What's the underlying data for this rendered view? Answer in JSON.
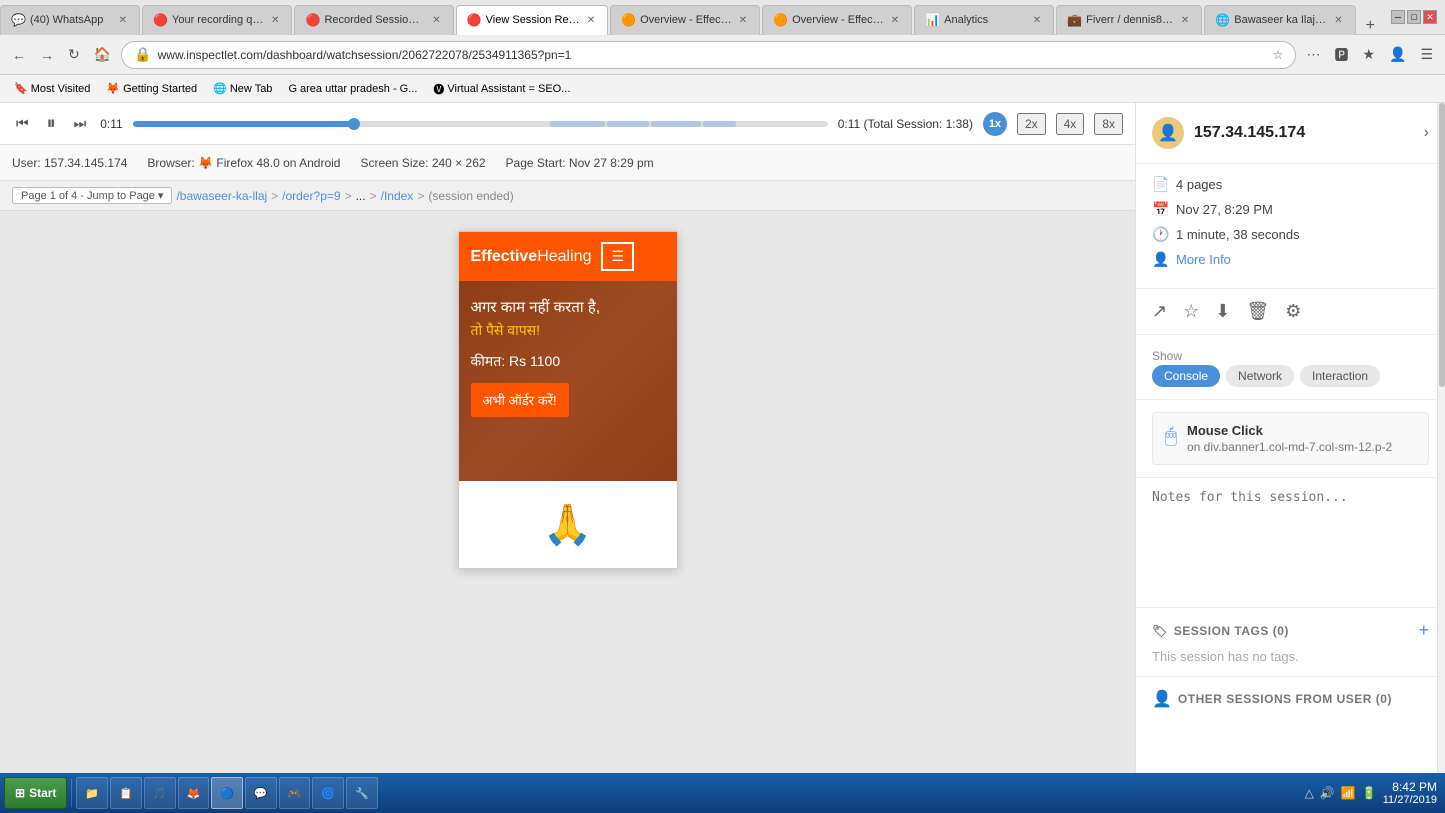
{
  "browser": {
    "tabs": [
      {
        "id": "whatsapp",
        "label": "(40) WhatsApp",
        "icon": "💬",
        "active": false,
        "favicon": "🟢"
      },
      {
        "id": "your-recording",
        "label": "Your recording qu...",
        "icon": "🔴",
        "active": false,
        "favicon": "📹"
      },
      {
        "id": "recorded-sessions",
        "label": "Recorded Sessions...",
        "icon": "🔴",
        "active": false,
        "favicon": "📹"
      },
      {
        "id": "view-session",
        "label": "View Session Rec...",
        "icon": "🔴",
        "active": true,
        "favicon": "📹"
      },
      {
        "id": "overview-effecti1",
        "label": "Overview - Effecti...",
        "icon": "🟠",
        "active": false,
        "favicon": "📊"
      },
      {
        "id": "overview-effecti2",
        "label": "Overview - Effecti...",
        "icon": "🟠",
        "active": false,
        "favicon": "📊"
      },
      {
        "id": "analytics",
        "label": "Analytics",
        "icon": "📊",
        "active": false,
        "favicon": "📊"
      },
      {
        "id": "fiverr",
        "label": "Fiverr / dennis81...",
        "icon": "🟢",
        "active": false,
        "favicon": "💼"
      },
      {
        "id": "bawaseer",
        "label": "Bawaseer ka Ilaj -...",
        "icon": "🟠",
        "active": false,
        "favicon": "🌐"
      }
    ],
    "url": "www.inspectlet.com/dashboard/watchsession/2062722078/2534911365?pn=1",
    "bookmarks": [
      {
        "label": "Most Visited"
      },
      {
        "label": "Getting Started"
      },
      {
        "label": "New Tab"
      },
      {
        "label": "area uttar pradesh - G..."
      },
      {
        "label": "Virtual Assistant = SEO..."
      }
    ]
  },
  "player": {
    "current_time": "0:11",
    "total_time": "0:11 (Total Session: 1:38)",
    "progress_percent": 32,
    "speed_current": "1x",
    "speeds": [
      "2x",
      "4x",
      "8x"
    ]
  },
  "session_info": {
    "user": "User: 157.34.145.174",
    "browser": "Browser: 🦊 Firefox 48.0 on Android",
    "screen_size": "Screen Size: 240 × 262",
    "page_start": "Page Start: Nov 27 8:29 pm"
  },
  "breadcrumb": {
    "page": "Page 1 of 4 - Jump to Page",
    "path": [
      {
        "text": "/bawaseer-ka-llaj",
        "type": "link"
      },
      {
        "text": ">",
        "type": "sep"
      },
      {
        "text": "/order?p=9",
        "type": "link"
      },
      {
        "text": ">",
        "type": "sep"
      },
      {
        "text": "...",
        "type": "text"
      },
      {
        "text": ">",
        "type": "sep"
      },
      {
        "text": "/Index",
        "type": "link"
      },
      {
        "text": ">",
        "type": "sep"
      },
      {
        "text": "(session ended)",
        "type": "ended"
      }
    ]
  },
  "site_preview": {
    "logo_part1": "Effective",
    "logo_part2": "Healing",
    "hero_text1": "अगर काम नहीं करता है,",
    "hero_text2": "तो पैसे वापस!",
    "hero_price": "कीमत: Rs 1100",
    "hero_btn": "अभी ऑर्डर करें!"
  },
  "right_panel": {
    "ip": "157.34.145.174",
    "pages": "4 pages",
    "datetime": "Nov 27, 8:29 PM",
    "duration": "1 minute, 38 seconds",
    "more_info_label": "More Info",
    "show_label": "Show",
    "show_tabs": [
      "Console",
      "Network",
      "Interaction"
    ],
    "event": {
      "title": "Mouse Click",
      "description": "on div.banner1.col-md-7.col-sm-12.p-2"
    },
    "notes_placeholder": "Notes for this session...",
    "tags_label": "SESSION TAGS (0)",
    "tags_empty": "This session has no tags.",
    "other_sessions_label": "OTHER SESSIONS FROM USER (0)"
  },
  "taskbar": {
    "start_label": "Start",
    "apps": [
      {
        "label": "📁",
        "title": "File Explorer"
      },
      {
        "label": "📋",
        "title": "Task Manager"
      },
      {
        "label": "🎵",
        "title": "VLC"
      },
      {
        "label": "🦊",
        "title": "Firefox"
      },
      {
        "label": "🔵",
        "title": "Chrome"
      },
      {
        "label": "💬",
        "title": "Skype"
      },
      {
        "label": "🎮",
        "title": "Game"
      },
      {
        "label": "🌀",
        "title": "App"
      }
    ],
    "clock_time": "8:42 PM",
    "clock_date": "11/27/2019"
  }
}
